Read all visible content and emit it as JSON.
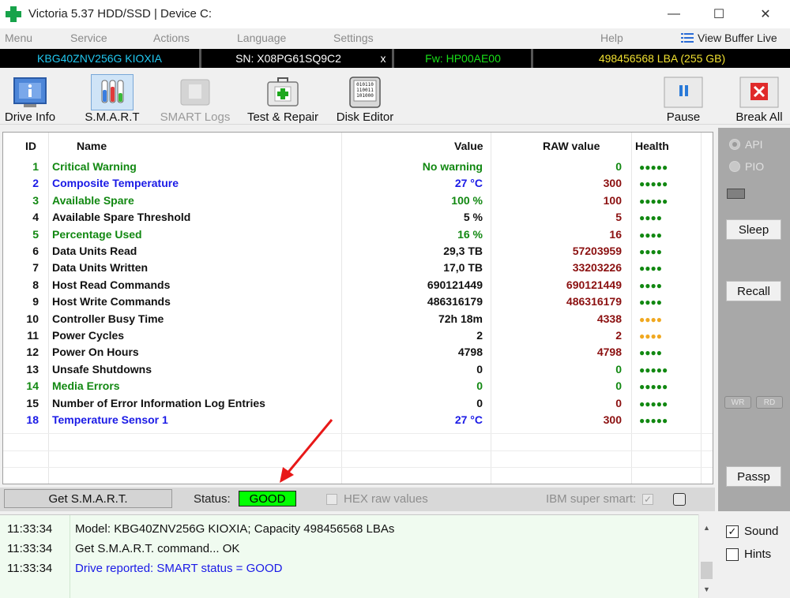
{
  "window": {
    "title": "Victoria 5.37 HDD/SSD | Device C:",
    "minimize": "—",
    "maximize": "☐",
    "close": "✕"
  },
  "menu": {
    "items": [
      "Menu",
      "Service",
      "Actions",
      "Language",
      "Settings",
      "Help"
    ],
    "view_buffer_live": "View Buffer Live"
  },
  "infobar": {
    "model": "KBG40ZNV256G KIOXIA",
    "serial": "SN: X08PG61SQ9C2",
    "close_x": "x",
    "firmware": "Fw: HP00AE00",
    "capacity": "498456568 LBA (255 GB)",
    "colors": {
      "model": "#21c8f0",
      "serial": "#ffffff",
      "firmware": "#18e018",
      "capacity": "#f0e030"
    }
  },
  "toolbar": {
    "buttons": [
      {
        "label": "Drive Info",
        "icon": "info-icon"
      },
      {
        "label": "S.M.A.R.T",
        "icon": "test-tubes-icon"
      },
      {
        "label": "SMART Logs",
        "icon": "folder-icon"
      },
      {
        "label": "Test & Repair",
        "icon": "first-aid-kit-icon"
      },
      {
        "label": "Disk Editor",
        "icon": "binary-disk-icon"
      },
      {
        "label": "Pause",
        "icon": "pause-icon"
      },
      {
        "label": "Break All",
        "icon": "stop-x-icon"
      }
    ]
  },
  "smart_table": {
    "headers": {
      "id": "ID",
      "name": "Name",
      "value": "Value",
      "raw": "RAW value",
      "health": "Health"
    },
    "rows": [
      {
        "id": "1",
        "name": "Critical Warning",
        "value": "No warning",
        "raw": "0",
        "health": "●●●●●",
        "name_color": "#118811",
        "value_color": "#118811",
        "raw_color": "#118811",
        "health_color": "#118811"
      },
      {
        "id": "2",
        "name": "Composite Temperature",
        "value": "27 °C",
        "raw": "300",
        "health": "●●●●●",
        "name_color": "#1a1ae6",
        "value_color": "#1a1ae6",
        "raw_color": "#8b1010",
        "health_color": "#118811"
      },
      {
        "id": "3",
        "name": "Available Spare",
        "value": "100 %",
        "raw": "100",
        "health": "●●●●●",
        "name_color": "#118811",
        "value_color": "#118811",
        "raw_color": "#8b1010",
        "health_color": "#118811"
      },
      {
        "id": "4",
        "name": "Available Spare Threshold",
        "value": "5 %",
        "raw": "5",
        "health": "●●●●",
        "name_color": "#111111",
        "value_color": "#111111",
        "raw_color": "#8b1010",
        "health_color": "#118811"
      },
      {
        "id": "5",
        "name": "Percentage Used",
        "value": "16 %",
        "raw": "16",
        "health": "●●●●",
        "name_color": "#118811",
        "value_color": "#118811",
        "raw_color": "#8b1010",
        "health_color": "#118811"
      },
      {
        "id": "6",
        "name": "Data Units Read",
        "value": "29,3 TB",
        "raw": "57203959",
        "health": "●●●●",
        "name_color": "#111111",
        "value_color": "#111111",
        "raw_color": "#8b1010",
        "health_color": "#118811"
      },
      {
        "id": "7",
        "name": "Data Units Written",
        "value": "17,0 TB",
        "raw": "33203226",
        "health": "●●●●",
        "name_color": "#111111",
        "value_color": "#111111",
        "raw_color": "#8b1010",
        "health_color": "#118811"
      },
      {
        "id": "8",
        "name": "Host Read Commands",
        "value": "690121449",
        "raw": "690121449",
        "health": "●●●●",
        "name_color": "#111111",
        "value_color": "#111111",
        "raw_color": "#8b1010",
        "health_color": "#118811"
      },
      {
        "id": "9",
        "name": "Host Write Commands",
        "value": "486316179",
        "raw": "486316179",
        "health": "●●●●",
        "name_color": "#111111",
        "value_color": "#111111",
        "raw_color": "#8b1010",
        "health_color": "#118811"
      },
      {
        "id": "10",
        "name": "Controller Busy Time",
        "value": "72h 18m",
        "raw": "4338",
        "health": "●●●●",
        "name_color": "#111111",
        "value_color": "#111111",
        "raw_color": "#8b1010",
        "health_color": "#f0a820"
      },
      {
        "id": "11",
        "name": "Power Cycles",
        "value": "2",
        "raw": "2",
        "health": "●●●●",
        "name_color": "#111111",
        "value_color": "#111111",
        "raw_color": "#8b1010",
        "health_color": "#f0a820"
      },
      {
        "id": "12",
        "name": "Power On Hours",
        "value": "4798",
        "raw": "4798",
        "health": "●●●●",
        "name_color": "#111111",
        "value_color": "#111111",
        "raw_color": "#8b1010",
        "health_color": "#118811"
      },
      {
        "id": "13",
        "name": "Unsafe Shutdowns",
        "value": "0",
        "raw": "0",
        "health": "●●●●●",
        "name_color": "#111111",
        "value_color": "#111111",
        "raw_color": "#118811",
        "health_color": "#118811"
      },
      {
        "id": "14",
        "name": "Media Errors",
        "value": "0",
        "raw": "0",
        "health": "●●●●●",
        "name_color": "#118811",
        "value_color": "#118811",
        "raw_color": "#118811",
        "health_color": "#118811"
      },
      {
        "id": "15",
        "name": "Number of Error Information Log Entries",
        "value": "0",
        "raw": "0",
        "health": "●●●●●",
        "name_color": "#111111",
        "value_color": "#111111",
        "raw_color": "#8b1010",
        "health_color": "#118811"
      },
      {
        "id": "18",
        "name": "Temperature Sensor 1",
        "value": "27 °C",
        "raw": "300",
        "health": "●●●●●",
        "name_color": "#1a1ae6",
        "value_color": "#1a1ae6",
        "raw_color": "#8b1010",
        "health_color": "#118811"
      }
    ]
  },
  "side_panel": {
    "api_label": "API",
    "pio_label": "PIO",
    "sleep": "Sleep",
    "recall": "Recall",
    "wr": "WR",
    "rd": "RD",
    "passp": "Passp"
  },
  "status_bar": {
    "get_smart": "Get S.M.A.R.T.",
    "status_label": "Status:",
    "status_value": "GOOD",
    "status_color": "#00ff00",
    "hex_raw": "HEX raw values",
    "ibm_super_smart": "IBM super smart:",
    "ibm_check": "✓"
  },
  "log": {
    "entries": [
      {
        "time": "11:33:34",
        "message": "Model: KBG40ZNV256G KIOXIA; Capacity 498456568 LBAs",
        "color": "#111111"
      },
      {
        "time": "11:33:34",
        "message": "Get S.M.A.R.T. command... OK",
        "color": "#111111"
      },
      {
        "time": "11:33:34",
        "message": "Drive reported: SMART status = GOOD",
        "color": "#1a1ae6"
      }
    ]
  },
  "options": {
    "sound": "Sound",
    "sound_check": "✓",
    "hints": "Hints"
  }
}
